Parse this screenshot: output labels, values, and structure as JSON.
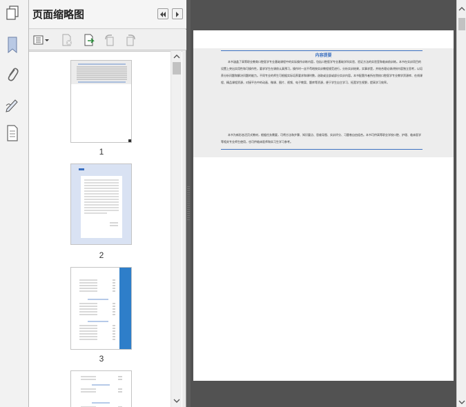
{
  "panel": {
    "title": "页面缩略图",
    "icons": {
      "pages": "pages-panel-icon",
      "bookmarks": "bookmark-icon",
      "attachments": "paperclip-icon",
      "signatures": "signature-pen-icon",
      "page_layers": "document-icon"
    },
    "header_buttons": [
      "collapse-left-icon",
      "expand-right-icon"
    ],
    "toolbar": [
      "options-menu-icon",
      "delete-page-icon",
      "insert-page-icon",
      "rotate-left-icon",
      "rotate-right-icon"
    ]
  },
  "thumbnails": [
    {
      "label": "1"
    },
    {
      "label": "2"
    },
    {
      "label": "3"
    }
  ],
  "document": {
    "summary_title": "内容提要",
    "paragraphs": [
      "本书涵盖了高等职业教育口腔医学专业基础课程中的实际操作训练内容，包括口腔医学专业基础学科实验、验证方法的实验室和临床前训练。本书在实训项目的设置上突出实用性和可操作性，要求学生在课前认真预习，操作时一丝不苟地按实训教程规范进行，分析实训结果，实事求是，并结合理论课讲授内容独立思考，以培养分析问题和解决问题的能力。不同专业的师生可根据实际培养要求和课时数，选取或全部或部分实训内容。本书配套作者所在院校口腔医学专业教学资源库、在线课程、精品课程资源，对接平台中的动画、微课、图片、视频、电子教案、题库等资源，便于学生自主学习、拓宽学生视野，提高学习效率。",
      "本书为新形态活页式教材，根据任务需要，可将方法和步骤、知识要点、思维导图、实训评分、习题卷自由组合。本书可供高等职业学校口腔、护理、临床医学等相关专业师生使用，也可供临床医师和实习生学习参考。"
    ]
  },
  "colors": {
    "accent_blue": "#3a6fc0",
    "thumb2_bg": "#d9e2f3",
    "thumb3_band": "#2e7ec9"
  }
}
